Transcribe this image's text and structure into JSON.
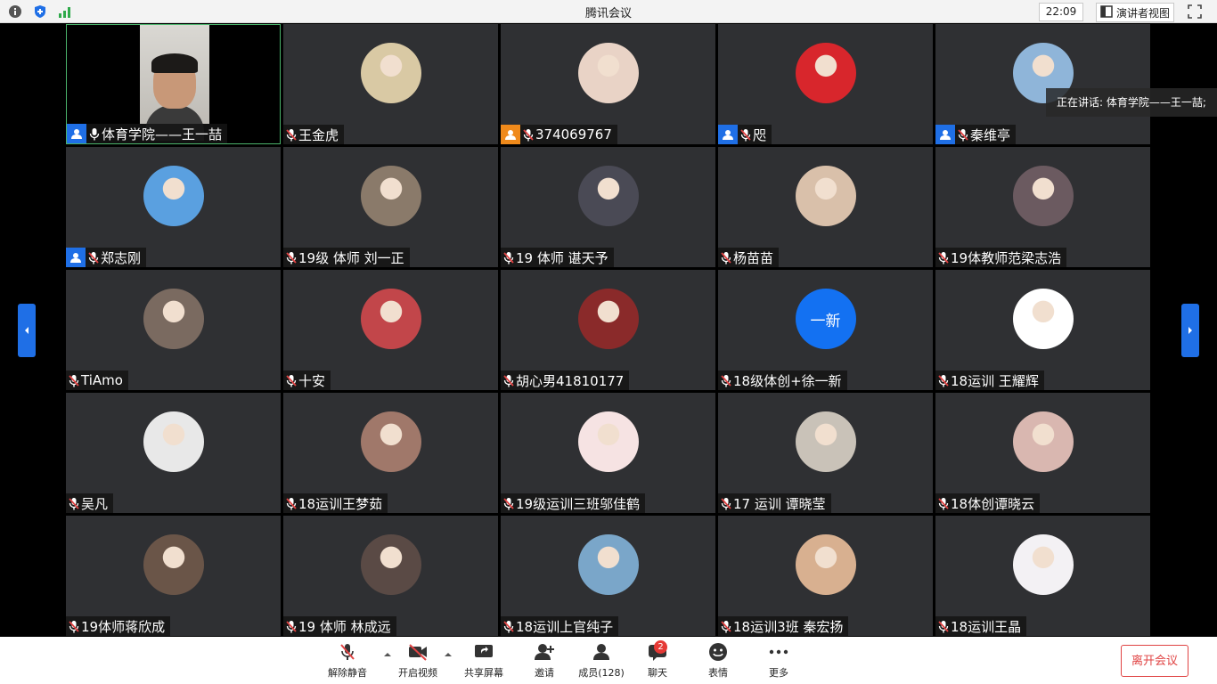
{
  "window": {
    "title": "腾讯会议",
    "time": "22:09",
    "speaker_view_label": "演讲者视图",
    "icons": [
      "info-icon",
      "shield-icon",
      "signal-icon",
      "fullscreen-icon"
    ]
  },
  "speaking_tooltip": "正在讲话: 体育学院——王一喆;",
  "participants": [
    {
      "name": "体育学院——王一喆",
      "badge": "host",
      "video": true,
      "avatar_color": "#000000"
    },
    {
      "name": "王金虎",
      "badge": "",
      "avatar_color": "#d9c9a4"
    },
    {
      "name": "374069767",
      "badge": "orange",
      "avatar_color": "#e9d3c6"
    },
    {
      "name": "咫",
      "badge": "host",
      "avatar_color": "#d8262c"
    },
    {
      "name": "秦维亭",
      "badge": "host",
      "avatar_color": "#8fb5d9"
    },
    {
      "name": "郑志刚",
      "badge": "host",
      "avatar_color": "#5aa0e0"
    },
    {
      "name": "19级 体师 刘一正",
      "badge": "",
      "avatar_color": "#8a7a6a"
    },
    {
      "name": "19 体师 谌天予",
      "badge": "",
      "avatar_color": "#4a4a55"
    },
    {
      "name": "杨苗苗",
      "badge": "",
      "avatar_color": "#d9c0aa"
    },
    {
      "name": "19体教师范梁志浩",
      "badge": "",
      "avatar_color": "#6b5a60"
    },
    {
      "name": "TiAmo",
      "badge": "",
      "avatar_color": "#7a6a60"
    },
    {
      "name": "十安",
      "badge": "",
      "avatar_color": "#c2464a"
    },
    {
      "name": "胡心男41810177",
      "badge": "",
      "avatar_color": "#8a2a2a"
    },
    {
      "name": "18级体创+徐一新",
      "badge": "",
      "avatar_text": "一新",
      "avatar_color": "#1371f2"
    },
    {
      "name": "18运训 王耀辉",
      "badge": "",
      "avatar_color": "#ffffff"
    },
    {
      "name": "吴凡",
      "badge": "",
      "avatar_color": "#e8e8e8"
    },
    {
      "name": "18运训王梦茹",
      "badge": "",
      "avatar_color": "#a0786a"
    },
    {
      "name": "19级运训三班邬佳鹤",
      "badge": "",
      "avatar_color": "#f6e3e3"
    },
    {
      "name": "17 运训 谭晓莹",
      "badge": "",
      "avatar_color": "#c9c2b8"
    },
    {
      "name": "18体创谭晓云",
      "badge": "",
      "avatar_color": "#d9b7b0"
    },
    {
      "name": "19体师蒋欣成",
      "badge": "",
      "avatar_color": "#6a5548"
    },
    {
      "name": "19  体师 林成远",
      "badge": "",
      "avatar_color": "#5a4a45"
    },
    {
      "name": "18运训上官纯子",
      "badge": "",
      "avatar_color": "#7aa6c9"
    },
    {
      "name": "18运训3班 秦宏扬",
      "badge": "",
      "avatar_color": "#d8b090"
    },
    {
      "name": "18运训王晶",
      "badge": "",
      "avatar_color": "#f3f1f4"
    }
  ],
  "toolbar": {
    "unmute": "解除静音",
    "start_video": "开启视频",
    "share_screen": "共享屏幕",
    "invite": "邀请",
    "members": "成员(128)",
    "chat": "聊天",
    "chat_badge": "2",
    "reactions": "表情",
    "more": "更多",
    "leave": "离开会议"
  },
  "colors": {
    "accent": "#1f6fe6",
    "tile_bg": "#2f3033",
    "leave": "#e04343",
    "active_border": "#4bb36b"
  }
}
